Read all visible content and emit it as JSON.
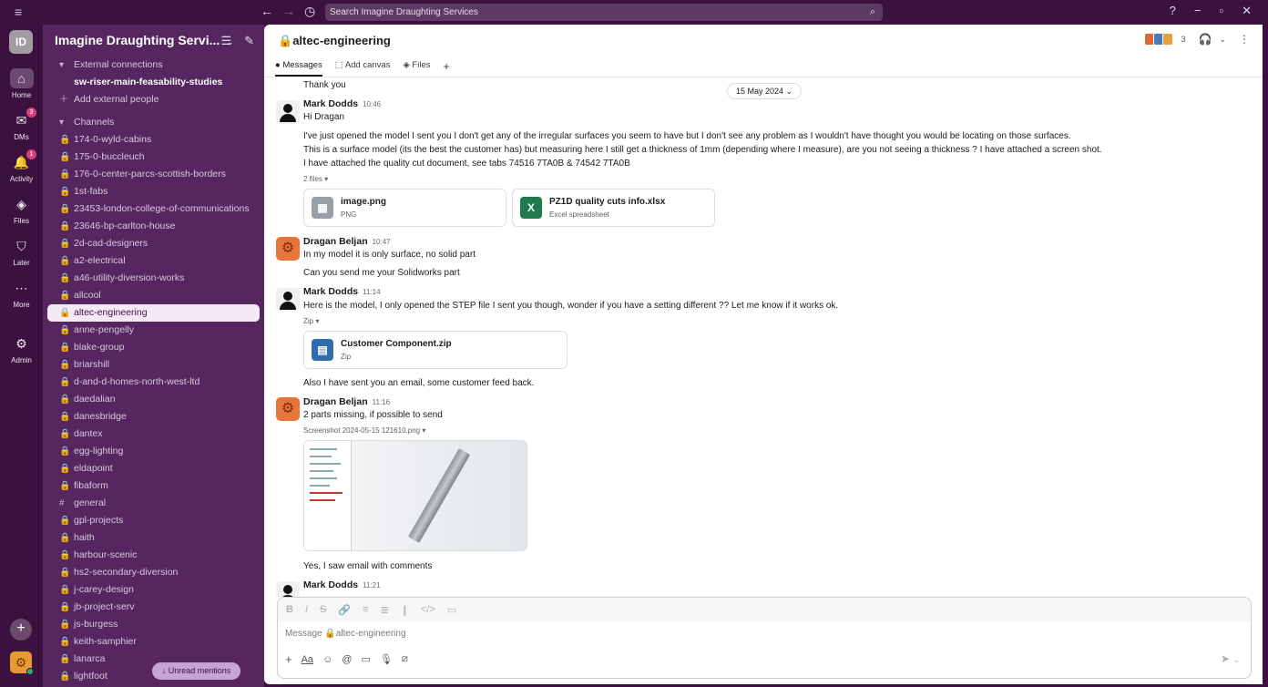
{
  "topbar": {
    "search_placeholder": "Search Imagine Draughting Services",
    "back": "←",
    "forward": "→",
    "history": "◷",
    "help": "?",
    "minimize": "−",
    "maximize": "▫",
    "close": "✕",
    "menu": "≡"
  },
  "rail": {
    "workspace_initials": "ID",
    "items": [
      {
        "label": "Home"
      },
      {
        "label": "DMs",
        "badge": "3"
      },
      {
        "label": "Activity",
        "badge": "1"
      },
      {
        "label": "Files"
      },
      {
        "label": "Later"
      },
      {
        "label": "More"
      },
      {
        "label": "Admin"
      }
    ]
  },
  "sidebar": {
    "workspace_name": "Imagine Draughting Servi...",
    "external_header": "External connections",
    "external_channel": "sw-riser-main-feasability-studies",
    "add_external": "Add external people",
    "channels_header": "Channels",
    "channels": [
      {
        "name": "174-0-wyld-cabins",
        "type": "lock"
      },
      {
        "name": "175-0-buccleuch",
        "type": "lock"
      },
      {
        "name": "176-0-center-parcs-scottish-borders",
        "type": "lock"
      },
      {
        "name": "1st-fabs",
        "type": "lock"
      },
      {
        "name": "23453-london-college-of-communications",
        "type": "lock"
      },
      {
        "name": "23646-bp-carlton-house",
        "type": "lock"
      },
      {
        "name": "2d-cad-designers",
        "type": "lock"
      },
      {
        "name": "a2-electrical",
        "type": "lock"
      },
      {
        "name": "a46-utility-diversion-works",
        "type": "lock"
      },
      {
        "name": "allcool",
        "type": "lock"
      },
      {
        "name": "altec-engineering",
        "type": "lock",
        "active": true
      },
      {
        "name": "anne-pengelly",
        "type": "lock"
      },
      {
        "name": "blake-group",
        "type": "lock"
      },
      {
        "name": "briarshill",
        "type": "lock"
      },
      {
        "name": "d-and-d-homes-north-west-ltd",
        "type": "lock"
      },
      {
        "name": "daedalian",
        "type": "lock"
      },
      {
        "name": "danesbridge",
        "type": "lock"
      },
      {
        "name": "dantex",
        "type": "lock"
      },
      {
        "name": "egg-lighting",
        "type": "lock"
      },
      {
        "name": "eldapoint",
        "type": "lock"
      },
      {
        "name": "fibaform",
        "type": "lock"
      },
      {
        "name": "general",
        "type": "hash"
      },
      {
        "name": "gpl-projects",
        "type": "lock"
      },
      {
        "name": "haith",
        "type": "lock"
      },
      {
        "name": "harbour-scenic",
        "type": "lock"
      },
      {
        "name": "hs2-secondary-diversion",
        "type": "lock"
      },
      {
        "name": "j-carey-design",
        "type": "lock"
      },
      {
        "name": "jb-project-serv",
        "type": "lock"
      },
      {
        "name": "js-burgess",
        "type": "lock"
      },
      {
        "name": "keith-samphier",
        "type": "lock"
      },
      {
        "name": "lanarca",
        "type": "lock"
      },
      {
        "name": "lightfoot",
        "type": "lock"
      }
    ],
    "unread_mentions": "↓ Unread mentions"
  },
  "channel": {
    "name": "altec-engineering",
    "member_count": "3",
    "tabs": [
      {
        "label": "Messages",
        "active": true
      },
      {
        "label": "Add canvas"
      },
      {
        "label": "Files"
      }
    ],
    "date_divider": "15 May 2024"
  },
  "messages": {
    "prev_tail": "Thank you",
    "m1": {
      "author": "Mark Dodds",
      "time": "10:46",
      "lines": [
        "Hi Dragan",
        "I've just opened the model I sent you I don't get any of the irregular surfaces you seem to have but I don't see any problem as I wouldn't have thought you would be locating on those surfaces.",
        "This is a surface model (its the best the customer has) but measuring here I still get a thickness of 1mm (depending where I measure), are you not seeing a thickness ? I have attached a screen shot.",
        "I have attached the quality cut document, see tabs 74516 7TA0B & 74542 7TA0B"
      ],
      "files_label": "2 files",
      "files": [
        {
          "name": "image.png",
          "type": "PNG"
        },
        {
          "name": "PZ1D quality cuts info.xlsx",
          "type": "Excel spreadsheet"
        }
      ]
    },
    "m2": {
      "author": "Dragan Beljan",
      "time": "10:47",
      "lines": [
        "In my model it is only surface, no solid part",
        "Can you send me your Solidworks part"
      ]
    },
    "m3": {
      "author": "Mark Dodds",
      "time": "11:14",
      "lines": [
        "Here is the model, I only opened the STEP file I sent you though, wonder if you have a setting different  ?? Let me know if it works ok."
      ],
      "files_label": "Zip",
      "file": {
        "name": "Customer Component.zip",
        "type": "Zip"
      },
      "after": "Also I have sent you an email, some customer feed back."
    },
    "m4": {
      "author": "Dragan Beljan",
      "time": "11:16",
      "lines": [
        "2 parts missing, if possible to send"
      ],
      "image_label": "Screenshot 2024-05-15 121610.png",
      "after": "Yes, I saw email with comments"
    },
    "m5": {
      "author": "Mark Dodds",
      "time": "11:21"
    }
  },
  "composer": {
    "placeholder": "Message 🔒altec-engineering",
    "format_tools": [
      "B",
      "I",
      "S",
      "🔗",
      "≡",
      "≣",
      "❙",
      "</>",
      "▭"
    ],
    "bottom_tools": [
      "+",
      "Aa",
      "☺",
      "@",
      "▭",
      "🎙",
      "⧄"
    ],
    "send": "➤"
  }
}
